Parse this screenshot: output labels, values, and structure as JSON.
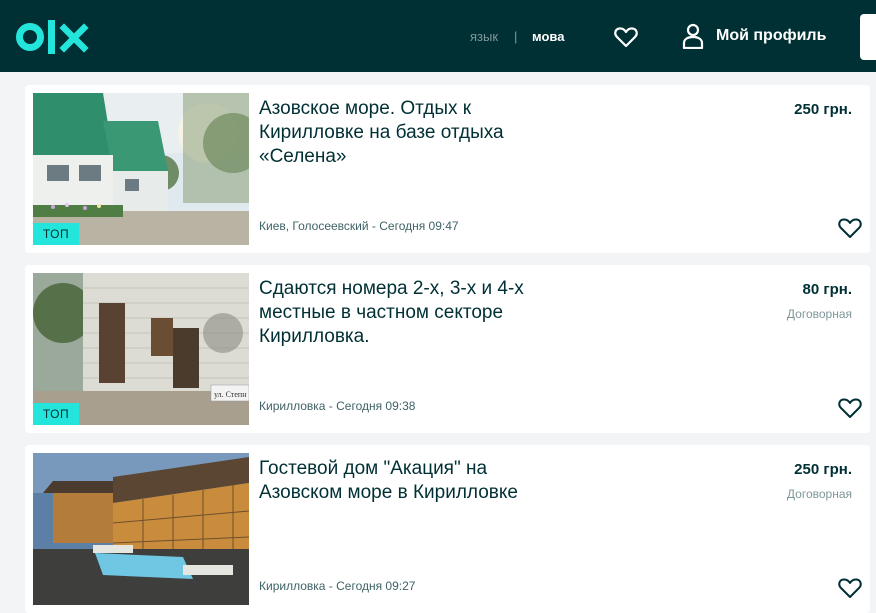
{
  "header": {
    "logo_text": "olx",
    "lang_ru": "язык",
    "lang_sep": "|",
    "lang_ua": "мова",
    "profile_label": "Мой профиль",
    "icons": {
      "logo": "olx-logo",
      "favorites": "heart-icon",
      "profile": "user-icon"
    }
  },
  "listings": [
    {
      "title": "Азовское море. Отдых к Кирилловке на базе отдыха «Селена»",
      "price": "250 грн.",
      "negotiable": "",
      "meta": "Киев, Голосеевский - Сегодня 09:47",
      "badge": "ТОП"
    },
    {
      "title": "Сдаются номера 2-х, 3-х и 4-х местные в частном секторе Кирилловка.",
      "price": "80 грн.",
      "negotiable": "Договорная",
      "meta": "Кирилловка - Сегодня 09:38",
      "badge": "ТОП",
      "photo_sign": "ул. Степн"
    },
    {
      "title": "Гостевой дом \"Акация\" на Азовском море в Кирилловке",
      "price": "250 грн.",
      "negotiable": "Договорная",
      "meta": "Кирилловка - Сегодня 09:27",
      "badge": ""
    }
  ],
  "colors": {
    "header_bg": "#002f34",
    "accent": "#23e5db",
    "page_bg": "#f2f4f5",
    "text_primary": "#002f34",
    "text_secondary": "#7f9799"
  }
}
